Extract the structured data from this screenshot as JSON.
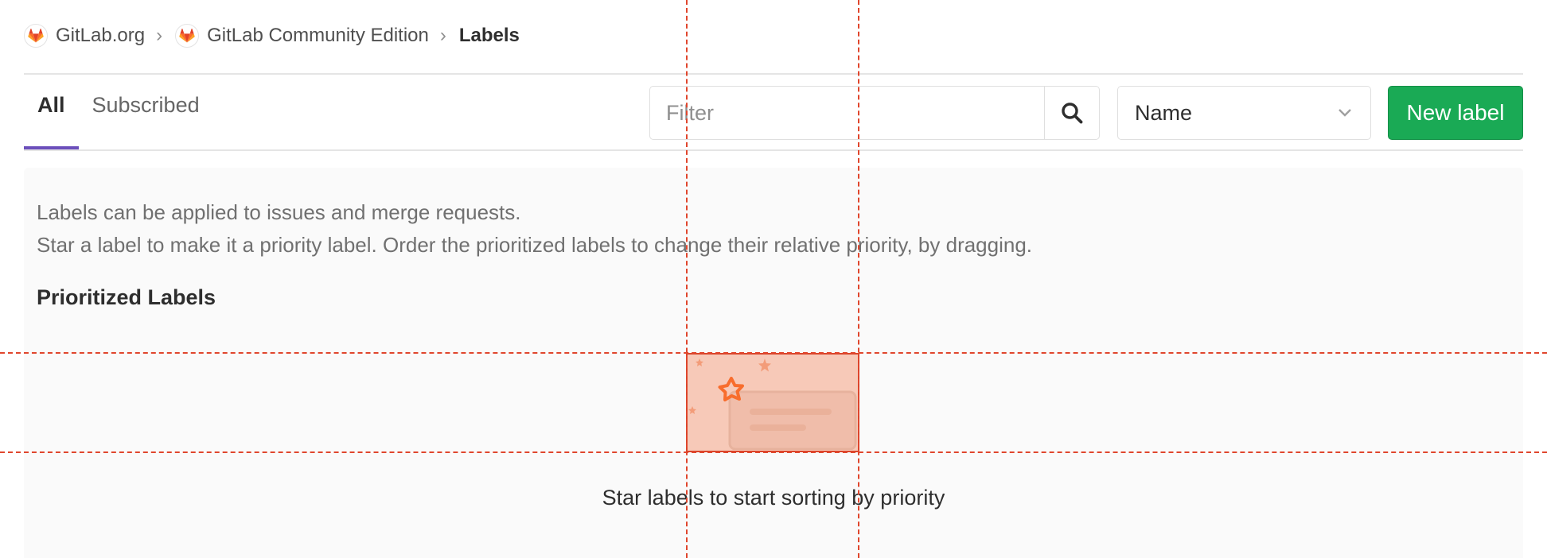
{
  "breadcrumb": {
    "items": [
      {
        "label": "GitLab.org"
      },
      {
        "label": "GitLab Community Edition"
      }
    ],
    "separator": "›",
    "current": "Labels"
  },
  "tabs": [
    {
      "label": "All",
      "active": true
    },
    {
      "label": "Subscribed",
      "active": false
    }
  ],
  "filter": {
    "placeholder": "Filter",
    "value": ""
  },
  "sort": {
    "selected": "Name"
  },
  "new_label_button": "New label",
  "panel": {
    "description_line1": "Labels can be applied to issues and merge requests.",
    "description_line2": "Star a label to make it a priority label. Order the prioritized labels to change their relative priority, by dragging.",
    "prioritized_title": "Prioritized Labels",
    "empty_message": "Star labels to start sorting by priority"
  },
  "colors": {
    "accent_tab": "#6b4fbb",
    "new_button": "#1aaa55",
    "overlay": "#e0462d",
    "star": "#fc6d26"
  },
  "icons": [
    "gitlab-logo-icon",
    "search-icon",
    "chevron-down-icon",
    "star-icon"
  ]
}
